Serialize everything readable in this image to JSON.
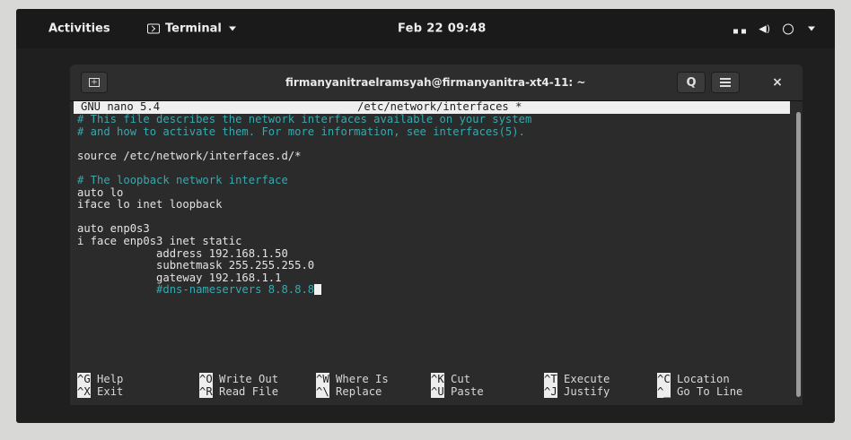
{
  "topbar": {
    "activities": "Activities",
    "app_menu": "Terminal",
    "clock": "Feb 22  09:48"
  },
  "window": {
    "title": "firmanyanitraelramsyah@firmanyanitra-xt4-11: ~",
    "close_glyph": "×"
  },
  "nano": {
    "version": "GNU nano 5.4",
    "filename": "/etc/network/interfaces *",
    "lines": [
      {
        "text": "# This file describes the network interfaces available on your system",
        "kind": "comment"
      },
      {
        "text": "# and how to activate them. For more information, see interfaces(5).",
        "kind": "comment"
      },
      {
        "text": "",
        "kind": "plain"
      },
      {
        "text": "source /etc/network/interfaces.d/*",
        "kind": "plain"
      },
      {
        "text": "",
        "kind": "plain"
      },
      {
        "text": "# The loopback network interface",
        "kind": "comment"
      },
      {
        "text": "auto lo",
        "kind": "plain"
      },
      {
        "text": "iface lo inet loopback",
        "kind": "plain"
      },
      {
        "text": "",
        "kind": "plain"
      },
      {
        "text": "auto enp0s3",
        "kind": "plain"
      },
      {
        "text": "i face enp0s3 inet static",
        "kind": "plain"
      },
      {
        "text": "            address 192.168.1.50",
        "kind": "plain"
      },
      {
        "text": "            subnetmask 255.255.255.0",
        "kind": "plain"
      },
      {
        "text": "            gateway 192.168.1.1",
        "kind": "plain"
      },
      {
        "text": "            #dns-nameservers 8.8.8.8",
        "kind": "comment",
        "cursor": true
      }
    ],
    "shortcuts": [
      {
        "key": "^G",
        "label": " Help"
      },
      {
        "key": "^X",
        "label": " Exit"
      },
      {
        "key": "^O",
        "label": " Write Out"
      },
      {
        "key": "^R",
        "label": " Read File"
      },
      {
        "key": "^W",
        "label": " Where Is"
      },
      {
        "key": "^\\",
        "label": " Replace"
      },
      {
        "key": "^K",
        "label": " Cut"
      },
      {
        "key": "^U",
        "label": " Paste"
      },
      {
        "key": "^T",
        "label": " Execute"
      },
      {
        "key": "^J",
        "label": " Justify"
      },
      {
        "key": "^C",
        "label": " Location"
      },
      {
        "key": "^_",
        "label": " Go To Line"
      }
    ]
  },
  "icons": {
    "terminal": "terminal-icon",
    "network": "network-icon",
    "volume": "volume-icon",
    "power": "power-icon",
    "new_tab": "new-tab-icon",
    "search": "search-icon",
    "menu": "hamburger-menu-icon",
    "close": "close-icon"
  }
}
